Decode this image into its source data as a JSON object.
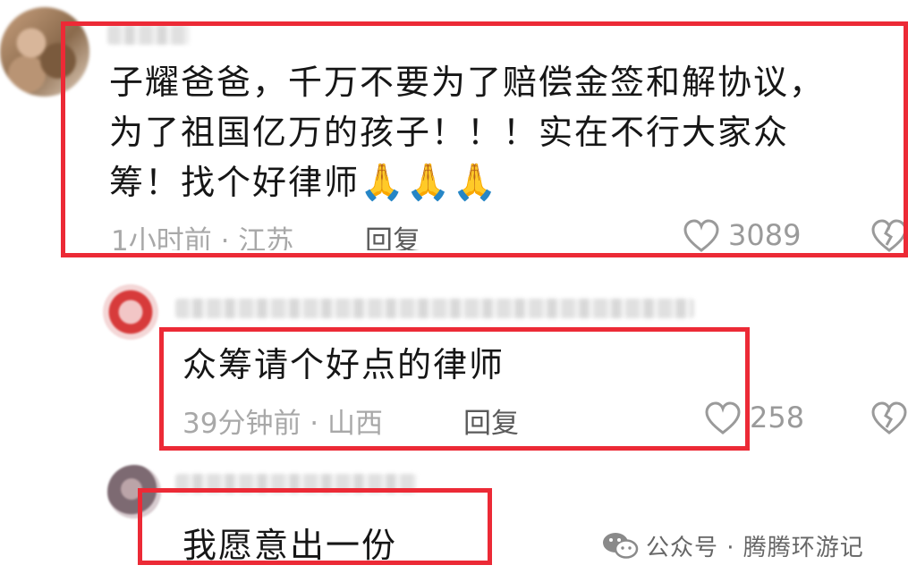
{
  "comments": [
    {
      "text_lines": [
        "子耀爸爸，千万不要为了赔偿金签和解协议，",
        "为了祖国亿万的孩子！！！实在不行大家众",
        "筹！找个好律师"
      ],
      "emoji": "🙏🙏🙏",
      "time_location": "1小时前 · 江苏",
      "reply_label": "回复",
      "likes": "3089"
    },
    {
      "text": "众筹请个好点的律师",
      "time_location": "39分钟前 · 山西",
      "reply_label": "回复",
      "likes": "258"
    },
    {
      "text": "我愿意出一份"
    }
  ],
  "watermark": {
    "text": "公众号 · 腾腾环游记"
  },
  "colors": {
    "highlight": "#ec2a36",
    "meta": "#a8a8a8",
    "wechat_green": "#8a8a8a"
  },
  "icons": [
    "heart-icon",
    "broken-heart-icon",
    "wechat-icon"
  ]
}
